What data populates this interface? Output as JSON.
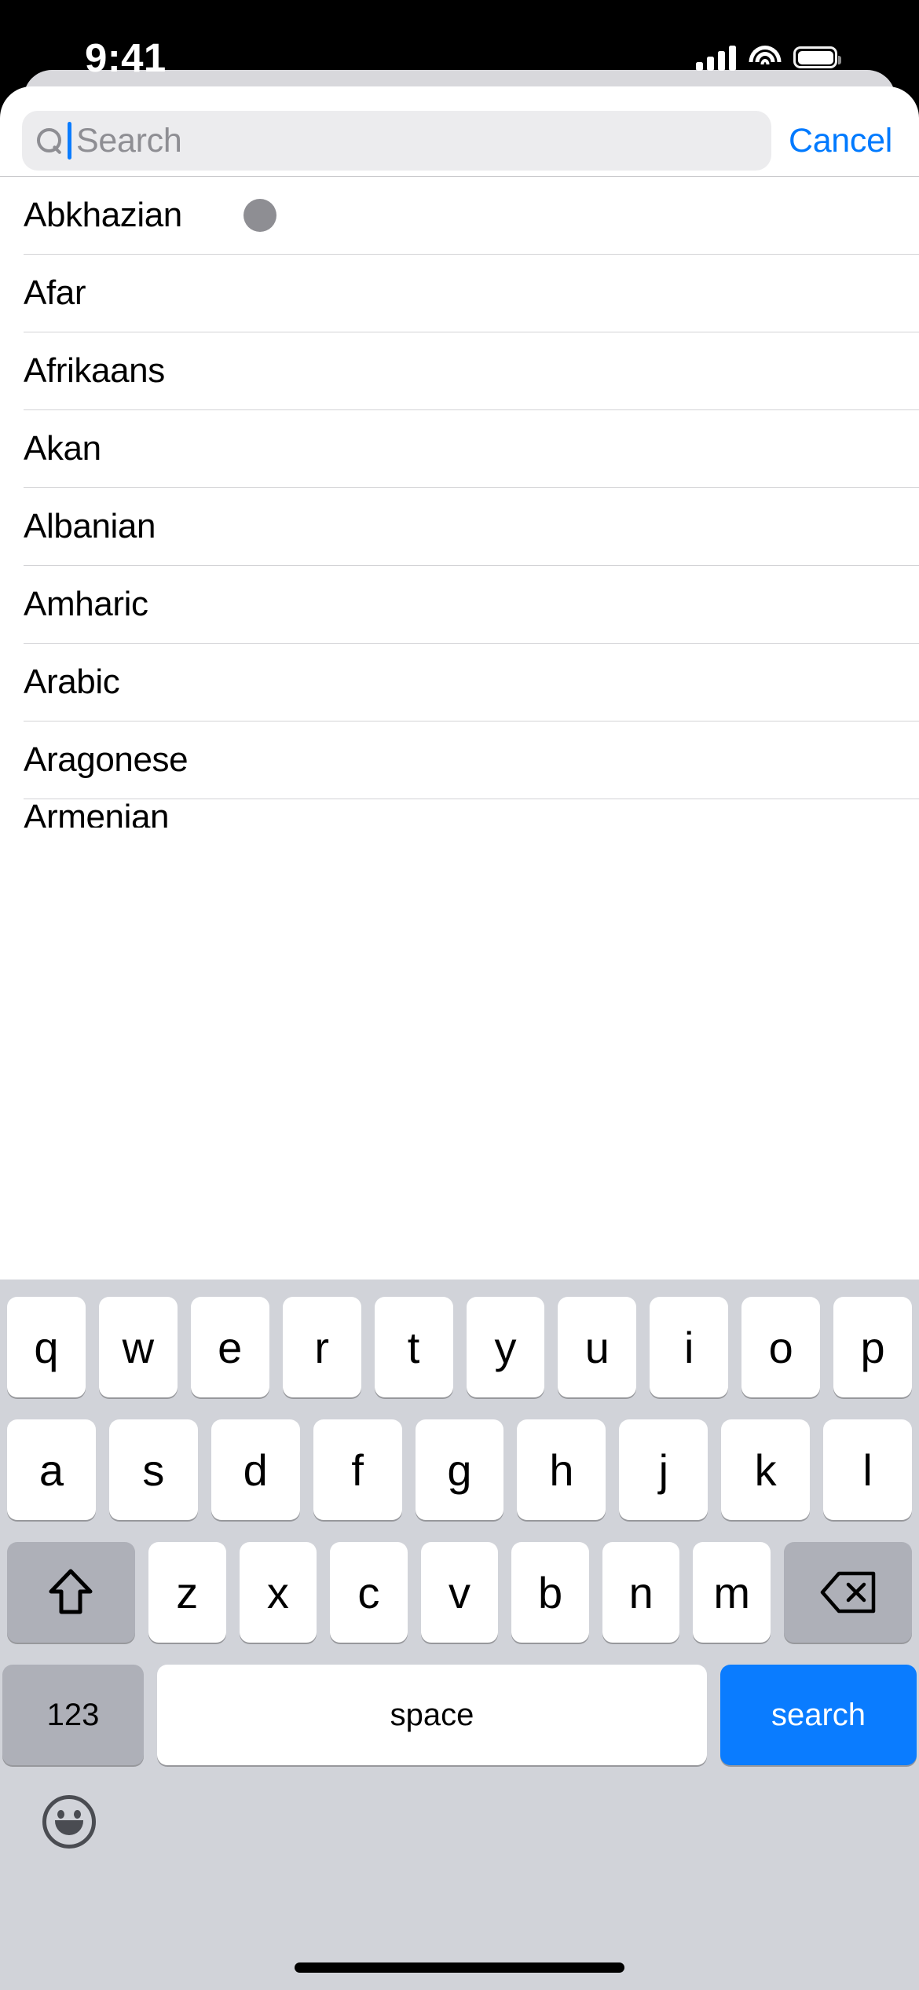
{
  "status_bar": {
    "time": "9:41",
    "cellular_icon": "cellular-bars-icon",
    "wifi_icon": "wifi-icon",
    "battery_icon": "battery-icon"
  },
  "search": {
    "icon": "search-icon",
    "placeholder": "Search",
    "value": "",
    "cancel_label": "Cancel",
    "cursor_visible": true
  },
  "colors": {
    "accent_blue": "#007aff",
    "caret_blue": "#0a7cff",
    "key_blue": "#0a7cff",
    "keyboard_bg": "#d1d3d9",
    "gray_key": "#aeb0b8",
    "dot_gray": "#8e8e93",
    "placeholder_gray": "#8e8e93",
    "separator": "#d3d3d6",
    "search_field_bg": "#ececee",
    "sheet_back": "#d8d8dc"
  },
  "list": {
    "rows": [
      {
        "label": "Abkhazian",
        "selected": true
      },
      {
        "label": "Afar",
        "selected": false
      },
      {
        "label": "Afrikaans",
        "selected": false
      },
      {
        "label": "Akan",
        "selected": false
      },
      {
        "label": "Albanian",
        "selected": false
      },
      {
        "label": "Amharic",
        "selected": false
      },
      {
        "label": "Arabic",
        "selected": false
      },
      {
        "label": "Aragonese",
        "selected": false
      }
    ],
    "partial_row": {
      "label": "Armenian"
    }
  },
  "keyboard": {
    "row1": [
      "q",
      "w",
      "e",
      "r",
      "t",
      "y",
      "u",
      "i",
      "o",
      "p"
    ],
    "row2": [
      "a",
      "s",
      "d",
      "f",
      "g",
      "h",
      "j",
      "k",
      "l"
    ],
    "row3_letters": [
      "z",
      "x",
      "c",
      "v",
      "b",
      "n",
      "m"
    ],
    "shift_icon": "shift-icon",
    "delete_icon": "delete-backspace-icon",
    "numbers_label": "123",
    "space_label": "space",
    "return_label": "search",
    "emoji_icon": "emoji-smiley-icon"
  }
}
